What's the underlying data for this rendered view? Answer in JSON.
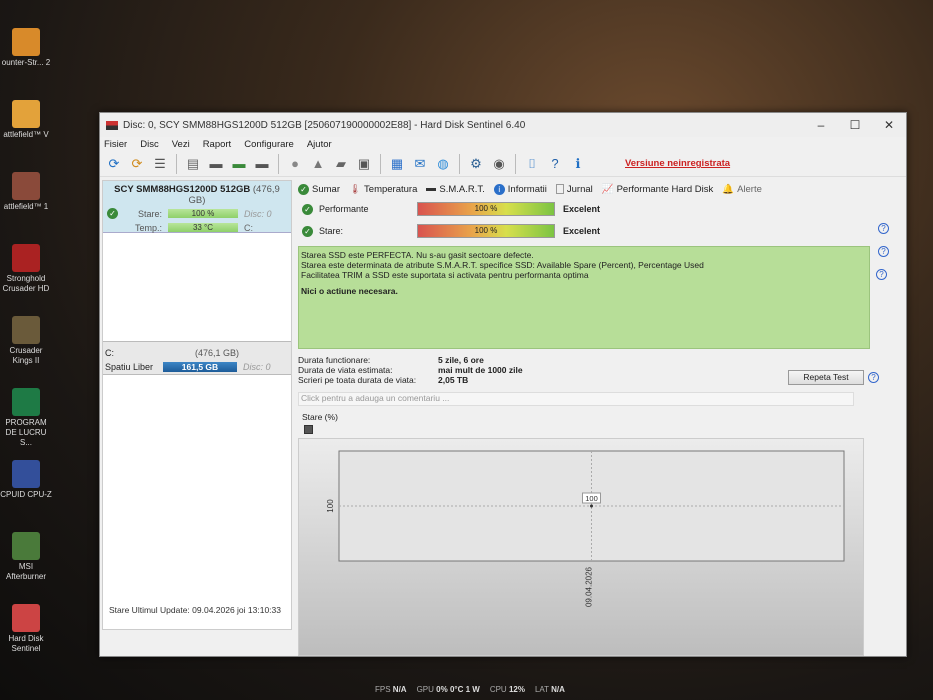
{
  "desktop": {
    "icons": [
      {
        "label": "ounter-Str... 2",
        "color": "#d88a2a"
      },
      {
        "label": "attlefield™ V",
        "color": "#e3a23a"
      },
      {
        "label": "attlefield™ 1",
        "color": "#8a4a3a"
      },
      {
        "label": "Stronghold Crusader HD",
        "color": "#aa2222"
      },
      {
        "label": "Crusader Kings II",
        "color": "#6a5a3a"
      },
      {
        "label": "PROGRAM DE LUCRU S...",
        "color": "#1e7a45"
      },
      {
        "label": "CPUID CPU-Z",
        "color": "#334f9a"
      },
      {
        "label": "MSI Afterburner",
        "color": "#4a7a3a"
      },
      {
        "label": "Hard Disk Sentinel",
        "color": "#c44"
      }
    ]
  },
  "window": {
    "title": "Disc: 0, SCY SMM88HGS1200D 512GB [250607190000002E88]  -  Hard Disk Sentinel 6.40",
    "minimize": "–",
    "maximize": "☐",
    "close": "✕"
  },
  "menu": [
    "Fisier",
    "Disc",
    "Vezi",
    "Raport",
    "Configurare",
    "Ajutor"
  ],
  "toolbar": {
    "groups": [
      [
        "refresh-icon",
        "refresh-warning-icon",
        "disk-list-icon"
      ],
      [
        "disk-surface-icon",
        "disk-schedule-icon",
        "disk-check-icon",
        "disk-search-icon"
      ],
      [
        "disk-gray-icon",
        "eject-icon",
        "drives-icon",
        "drive-tools-icon"
      ],
      [
        "report-icon",
        "email-icon",
        "network-icon"
      ],
      [
        "settings-icon",
        "sound-icon"
      ],
      [
        "screenshot-icon",
        "help-icon",
        "info-icon"
      ]
    ],
    "unregistered": "Versiune neinregistrata"
  },
  "left": {
    "disk_name": "SCY SMM88HGS1200D 512GB",
    "disk_size": "(476,9 GB)",
    "stare_label": "Stare:",
    "stare_value": "100 %",
    "disc": "Disc: 0",
    "temp_label": "Temp.:",
    "temp_value": "33 °C",
    "drive": "C:",
    "partition": {
      "letter": "C:",
      "size": "(476,1 GB)",
      "free_label": "Spatiu Liber",
      "free_value": "161,5 GB",
      "disc": "Disc: 0"
    },
    "status": "Stare Ultimul Update: 09.04.2026 joi 13:10:33"
  },
  "tabs": [
    "Sumar",
    "Temperatura",
    "S.M.A.R.T.",
    "Informatii",
    "Jurnal",
    "Performante Hard Disk",
    "Alerte"
  ],
  "summary": {
    "performance": {
      "label": "Performante",
      "value": "100 %",
      "percent": 100,
      "rating": "Excelent"
    },
    "health": {
      "label": "Stare:",
      "value": "100 %",
      "percent": 100,
      "rating": "Excelent"
    },
    "messages": [
      "Starea SSD este PERFECTA. Nu s-au gasit sectoare defecte.",
      "Starea este determinata de atribute S.M.A.R.T. specifice SSD: Available Spare (Percent), Percentage Used",
      "Facilitatea TRIM a SSD este suportata si activata pentru performanta optima"
    ],
    "action": "Nici o actiune necesara.",
    "info": [
      {
        "label": "Durata functionare:",
        "value": "5 zile, 6 ore"
      },
      {
        "label": "Durata de viata estimata:",
        "value": "mai mult de 1000 zile"
      },
      {
        "label": "Scrieri pe toata durata de viata:",
        "value": "2,05 TB"
      }
    ],
    "retest": "Repeta Test",
    "comment_placeholder": "Click pentru a adauga un comentariu ...",
    "chart_title": "Stare (%)"
  },
  "chart_data": {
    "type": "line",
    "title": "Stare (%)",
    "x": [
      "09.04.2026"
    ],
    "values": [
      100
    ],
    "ytick": "100",
    "point_label": "100"
  },
  "taskbar": {
    "fps_label": "FPS",
    "fps": "N/A",
    "gpu_label": "GPU",
    "gpu": "0% 0°C 1 W",
    "cpu_label": "CPU",
    "cpu": "12%",
    "lat_label": "LAT",
    "lat": "N/A"
  }
}
